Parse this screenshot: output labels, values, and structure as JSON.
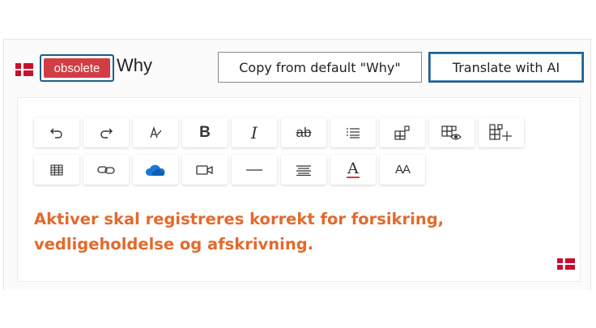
{
  "header": {
    "language_flag": "danish-flag-icon",
    "badge_label": "obsolete",
    "title": "Why",
    "copy_button_label": "Copy from default \"Why\"",
    "translate_button_label": "Translate with AI"
  },
  "toolbar": {
    "row1": [
      "undo-icon",
      "redo-icon",
      "format-painter-icon",
      "bold-icon",
      "italic-icon",
      "strikethrough-icon",
      "bullet-list-icon",
      "insert-block-icon",
      "preview-block-icon",
      "add-block-icon"
    ],
    "row2": [
      "table-icon",
      "link-icon",
      "onedrive-icon",
      "video-icon",
      "horizontal-rule-icon",
      "align-icon",
      "font-color-icon",
      "font-size-icon"
    ],
    "bold_glyph": "B",
    "italic_glyph": "I",
    "strike_glyph": "ab",
    "fontcolor_glyph": "A",
    "fontsize_glyph": "AA"
  },
  "editor": {
    "content": "Aktiver skal registreres korrekt for forsikring, vedligeholdelse og afskrivning.",
    "language_flag": "danish-flag-icon"
  },
  "colors": {
    "accent": "#1a5f8d",
    "badge": "#d13d44",
    "content_text": "#e26a2c"
  }
}
